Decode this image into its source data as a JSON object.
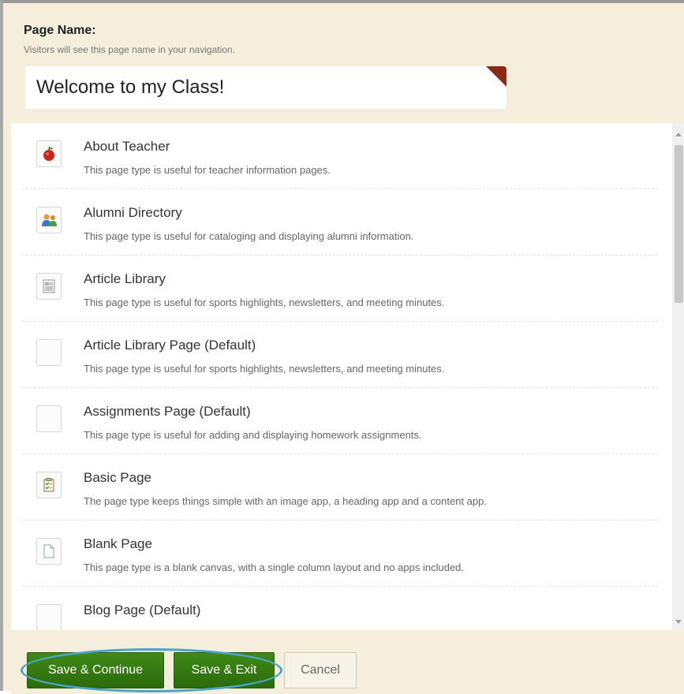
{
  "header": {
    "label": "Page Name:",
    "hint": "Visitors will see this page name in your navigation.",
    "page_name_value": "Welcome to my Class!"
  },
  "page_types": [
    {
      "title": "About Teacher",
      "description": "This page type is useful for teacher information pages.",
      "icon": "apple-icon"
    },
    {
      "title": "Alumni Directory",
      "description": "This page type is useful for cataloging and displaying alumni information.",
      "icon": "people-icon"
    },
    {
      "title": "Article Library",
      "description": "This page type is useful for sports highlights, newsletters, and meeting minutes.",
      "icon": "newspaper-icon"
    },
    {
      "title": "Article Library Page (Default)",
      "description": "This page type is useful for sports highlights, newsletters, and meeting minutes.",
      "icon": "blank-icon"
    },
    {
      "title": "Assignments Page (Default)",
      "description": "This page type is useful for adding and displaying homework assignments.",
      "icon": "blank-icon"
    },
    {
      "title": "Basic Page",
      "description": "The page type keeps things simple with an image app, a heading app and a content app.",
      "icon": "clipboard-icon"
    },
    {
      "title": "Blank Page",
      "description": "This page type is a blank canvas, with a single column layout and no apps included.",
      "icon": "document-icon"
    },
    {
      "title": "Blog Page (Default)",
      "description": "",
      "icon": "blank-icon"
    }
  ],
  "footer": {
    "save_continue": "Save & Continue",
    "save_exit": "Save & Exit",
    "cancel": "Cancel"
  },
  "colors": {
    "background": "#f5eedd",
    "button_green": "#2c6b0c",
    "highlight": "#4aa6c8",
    "corner_flag": "#8a2a14"
  }
}
